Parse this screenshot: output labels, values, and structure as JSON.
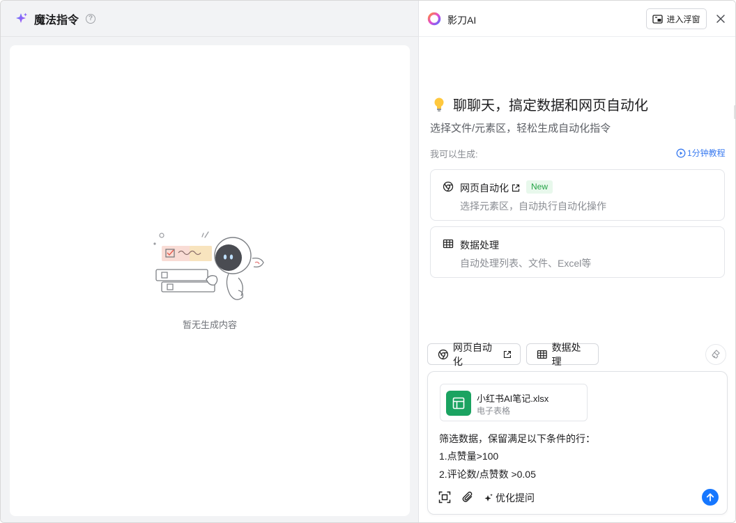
{
  "left_panel": {
    "title": "魔法指令",
    "empty_text": "暂无生成内容"
  },
  "right_panel": {
    "brand_name": "影刀AI",
    "float_button": "进入浮窗",
    "intro": {
      "title": "聊聊天，搞定数据和网页自动化",
      "subtitle": "选择文件/元素区，轻松生成自动化指令",
      "can_generate": "我可以生成:",
      "tutorial": "1分钟教程"
    },
    "features": [
      {
        "title": "网页自动化",
        "badge": "New",
        "desc": "选择元素区，自动执行自动化操作",
        "icon": "chrome-icon"
      },
      {
        "title": "数据处理",
        "desc": "自动处理列表、文件、Excel等",
        "icon": "table-icon"
      }
    ],
    "chips": [
      {
        "label": "网页自动化",
        "icon": "chrome-icon"
      },
      {
        "label": "数据处理",
        "icon": "table-icon"
      }
    ],
    "composer": {
      "file_name": "小红书AI笔记.xlsx",
      "file_type": "电子表格",
      "prompt_lines": [
        "筛选数据，保留满足以下条件的行：",
        "1.点赞量>100",
        "2.评论数/点赞数 >0.05"
      ],
      "optimize_label": "优化提问"
    }
  },
  "colors": {
    "accent": "#1677ff",
    "link": "#3a7bf0",
    "new_badge_bg": "#e8f8ec",
    "new_badge_text": "#22a244",
    "spreadsheet": "#1ba361"
  }
}
